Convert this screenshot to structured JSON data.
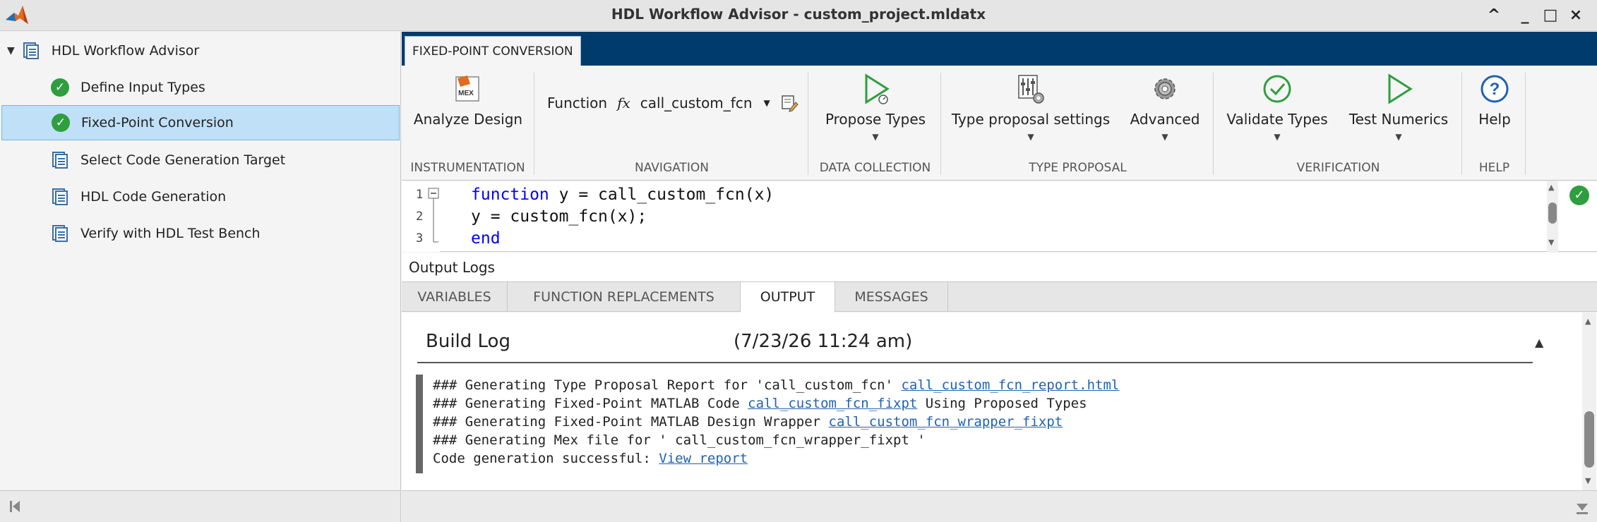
{
  "window": {
    "title": "HDL Workflow Advisor - custom_project.mldatx",
    "controls": [
      "^",
      "_",
      "□",
      "×"
    ]
  },
  "tree": {
    "root": "HDL Workflow Advisor",
    "items": [
      {
        "label": "Define Input Types",
        "status": "check"
      },
      {
        "label": "Fixed-Point Conversion",
        "status": "check",
        "selected": true
      },
      {
        "label": "Select Code Generation Target",
        "status": "doc"
      },
      {
        "label": "HDL Code Generation",
        "status": "doc"
      },
      {
        "label": "Verify with HDL Test Bench",
        "status": "doc"
      }
    ]
  },
  "ribbon": {
    "tab": "FIXED-POINT CONVERSION",
    "sections": {
      "instrumentation": "INSTRUMENTATION",
      "navigation": "NAVIGATION",
      "data_collection": "DATA COLLECTION",
      "type_proposal": "TYPE PROPOSAL",
      "verification": "VERIFICATION",
      "help": "HELP"
    },
    "buttons": {
      "analyze_design": "Analyze Design",
      "mex_badge": "MEX",
      "function_label": "Function",
      "fx_symbol": "fx",
      "function_value": "call_custom_fcn",
      "propose_types": "Propose Types",
      "type_proposal_settings": "Type proposal settings",
      "advanced": "Advanced",
      "validate_types": "Validate Types",
      "test_numerics": "Test Numerics",
      "help": "Help"
    }
  },
  "editor": {
    "lines": [
      {
        "n": "1",
        "kw": "function",
        "rest": " y = call_custom_fcn(x)"
      },
      {
        "n": "2",
        "kw": "",
        "rest": "y = custom_fcn(x);"
      },
      {
        "n": "3",
        "kw": "end",
        "rest": ""
      }
    ]
  },
  "logs": {
    "header": "Output Logs",
    "tabs": [
      "VARIABLES",
      "FUNCTION REPLACEMENTS",
      "OUTPUT",
      "MESSAGES"
    ],
    "active_tab": "OUTPUT",
    "build_log_title": "Build Log",
    "build_log_time": "(7/23/26 11:24 am)",
    "lines": [
      {
        "text": "### Generating Type Proposal Report for 'call_custom_fcn' ",
        "link": "call_custom_fcn_report.html",
        "after": ""
      },
      {
        "text": "### Generating Fixed-Point MATLAB Code ",
        "link": "call_custom_fcn_fixpt",
        "after": " Using Proposed Types"
      },
      {
        "text": "### Generating Fixed-Point MATLAB Design Wrapper ",
        "link": "call_custom_fcn_wrapper_fixpt",
        "after": ""
      },
      {
        "text": "### Generating Mex file for ' call_custom_fcn_wrapper_fixpt '",
        "link": "",
        "after": ""
      },
      {
        "text": "Code generation successful: ",
        "link": "View report",
        "after": ""
      }
    ]
  },
  "colors": {
    "tabstrip": "#003b6e",
    "check_green": "#2e9e3e",
    "link_blue": "#1f62b0",
    "selection": "#bfe0f7"
  }
}
